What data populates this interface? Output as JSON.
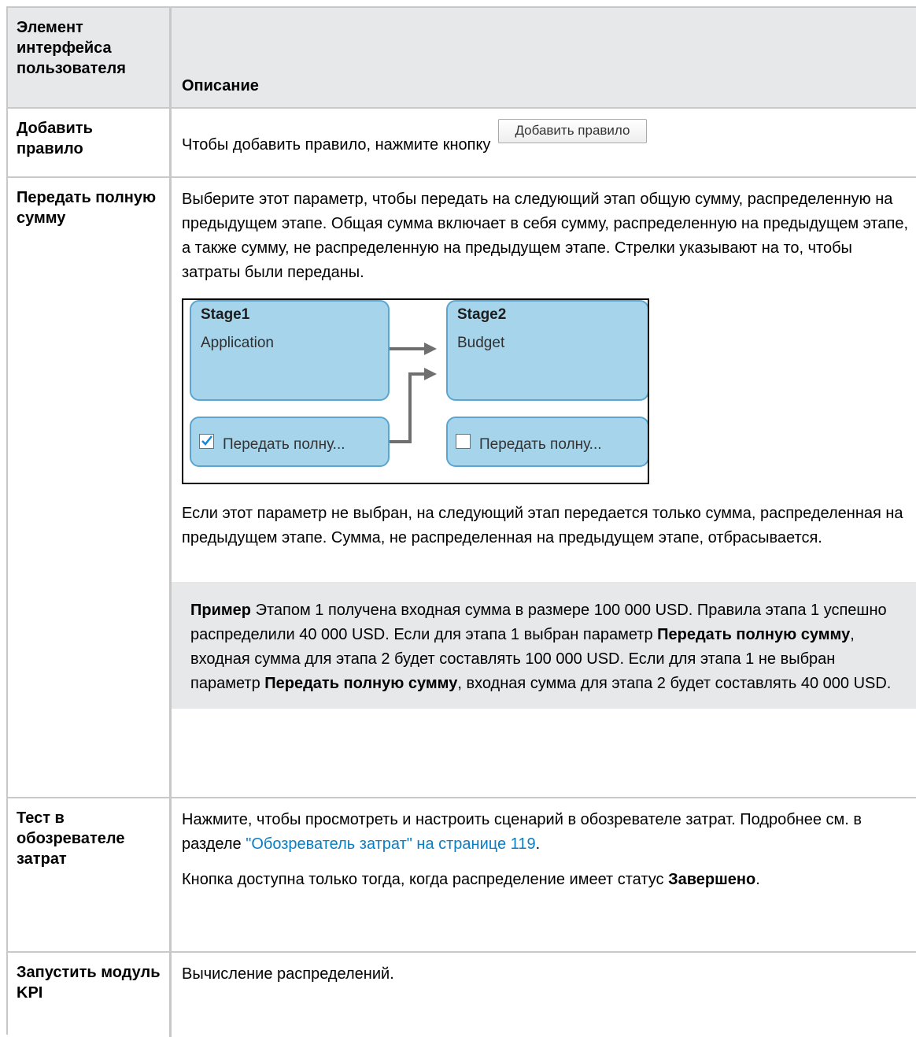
{
  "header": {
    "col1": "Элемент интерфейса пользователя",
    "col2": "Описание"
  },
  "rows": {
    "add_rule": {
      "name": "Добавить правило",
      "text": "Чтобы добавить правило, нажмите кнопку",
      "button_label": "Добавить правило"
    },
    "pass_full": {
      "name": "Передать полную сумму",
      "para1": "Выберите этот параметр, чтобы передать на следующий этап общую сумму, распределенную на предыдущем этапе. Общая сумма включает в себя сумму, распределенную на предыдущем этапе, а также сумму, не распределенную на предыдущем этапе. Стрелки указывают на то, чтобы затраты были переданы.",
      "para2": "Если этот параметр не выбран, на следующий этап передается только сумма, распределенная на предыдущем этапе. Сумма, не распределенная на предыдущем этапе, отбрасывается.",
      "diagram": {
        "stage1_title": "Stage1",
        "stage1_sub": "Application",
        "stage2_title": "Stage2",
        "stage2_sub": "Budget",
        "checkbox1_label": "Передать полну...",
        "checkbox1_checked": true,
        "checkbox2_label": "Передать полну...",
        "checkbox2_checked": false,
        "color_fill": "#a6d4ea",
        "color_border": "#5aa6d0"
      },
      "note": {
        "prefix": "Пример",
        "t1": " Этапом 1 получена входная сумма в размере 100 000 USD. Правила этапа 1 успешно распределили 40 000 USD. Если для этапа 1 выбран параметр ",
        "b1": "Передать полную сумму",
        "t2": ", входная сумма для этапа 2 будет составлять 100 000 USD. Если для этапа 1 не выбран параметр ",
        "b2": "Передать полную сумму",
        "t3": ", входная сумма для этапа 2 будет составлять 40 000 USD."
      }
    },
    "test_explorer": {
      "name": "Тест в обозревателе затрат",
      "p1a": "Нажмите, чтобы просмотреть и настроить сценарий в обозревателе затрат. Подробнее см. в разделе ",
      "link": "\"Обозреватель затрат\" на странице 119",
      "p1b": ".",
      "p2a": "Кнопка доступна только тогда, когда распределение имеет статус ",
      "p2b": "Завершено",
      "p2c": "."
    },
    "run_kpi": {
      "name": "Запустить модуль KPI",
      "text": "Вычисление распределений."
    }
  },
  "colors": {
    "header_bg": "#e6e8ea",
    "link": "#0a7ec2",
    "border": "#c8c8c8"
  }
}
